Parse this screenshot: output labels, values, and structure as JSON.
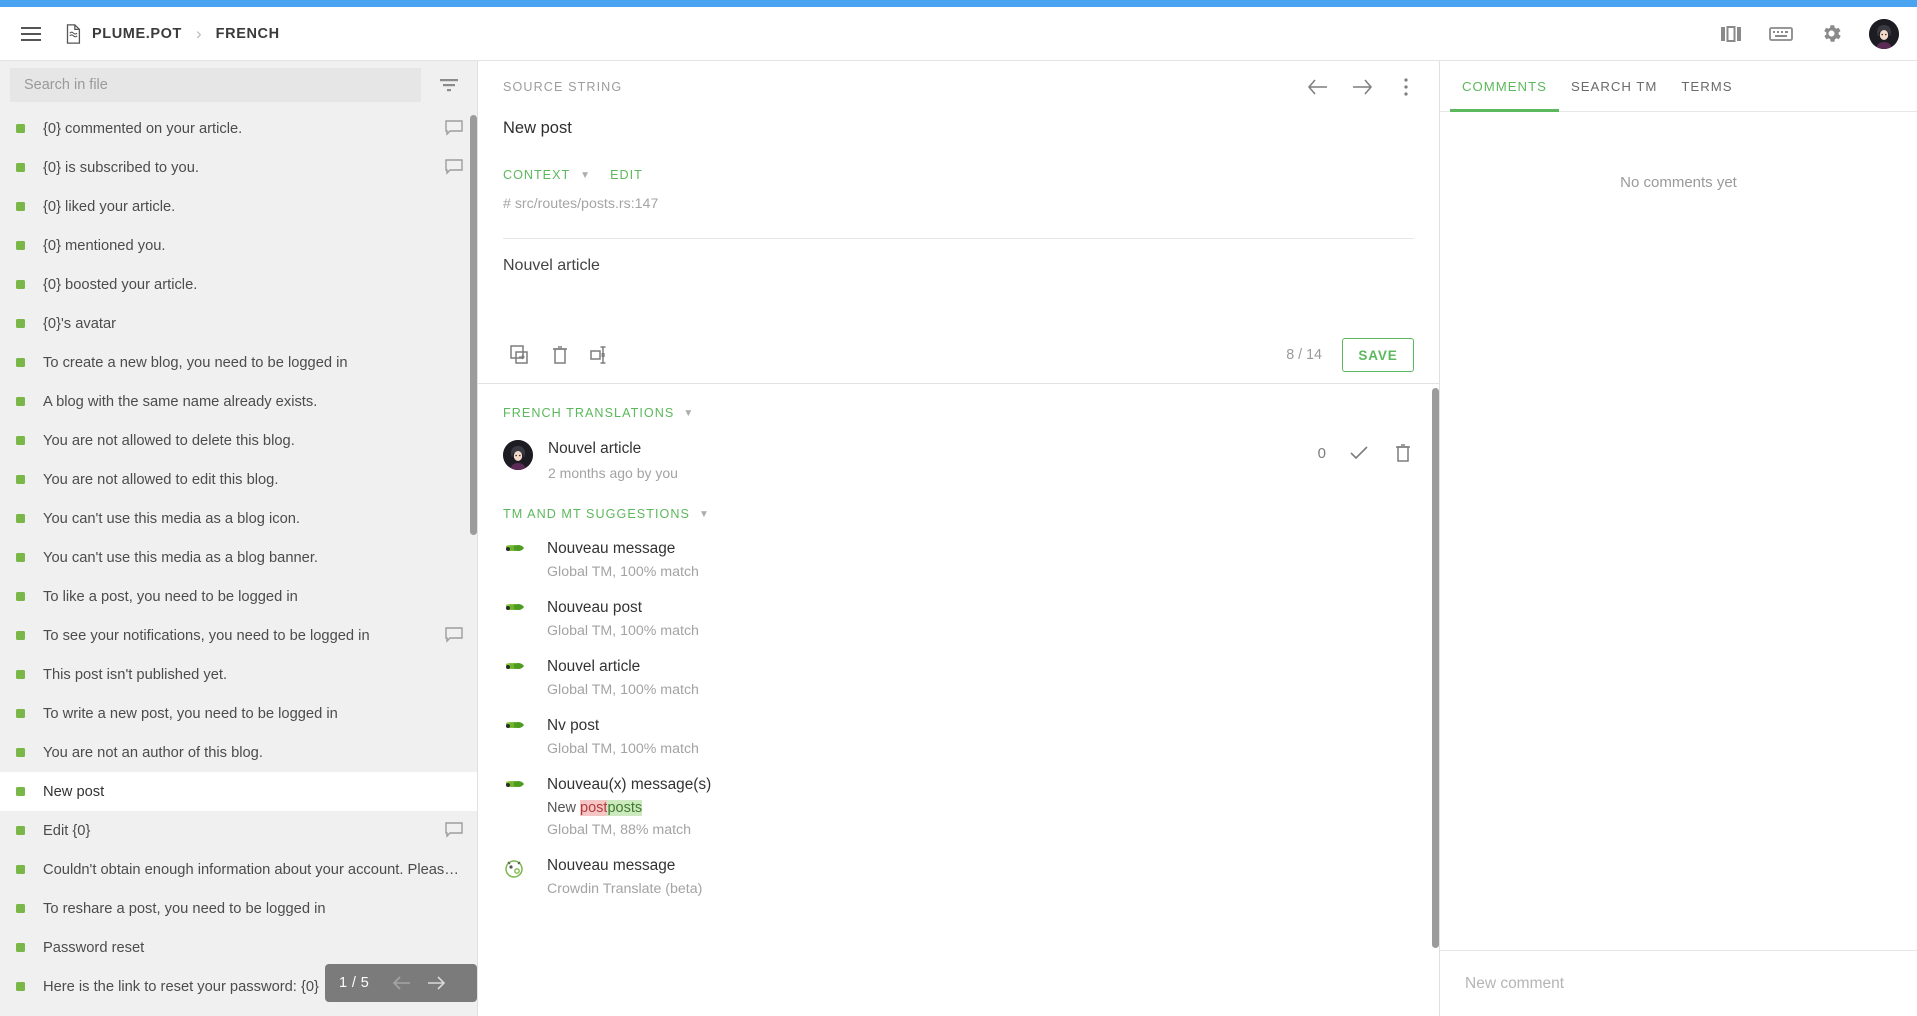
{
  "header": {
    "menu_icon": "hamburger-menu-icon",
    "project_name": "PLUME.POT",
    "separator": "›",
    "current_page": "FRENCH",
    "icons": [
      "layout-columns-icon",
      "keyboard-icon",
      "gear-icon"
    ],
    "avatar": "user-avatar"
  },
  "sidebar": {
    "search": {
      "placeholder": "Search in file",
      "value": ""
    },
    "filter_icon": "filter-icon",
    "items": [
      {
        "label": "{0} commented on your article.",
        "has_comment": true,
        "selected": false
      },
      {
        "label": "{0} is subscribed to you.",
        "has_comment": true,
        "selected": false
      },
      {
        "label": "{0} liked your article.",
        "has_comment": false,
        "selected": false
      },
      {
        "label": "{0} mentioned you.",
        "has_comment": false,
        "selected": false
      },
      {
        "label": "{0} boosted your article.",
        "has_comment": false,
        "selected": false
      },
      {
        "label": "{0}'s avatar",
        "has_comment": false,
        "selected": false
      },
      {
        "label": "To create a new blog, you need to be logged in",
        "has_comment": false,
        "selected": false
      },
      {
        "label": "A blog with the same name already exists.",
        "has_comment": false,
        "selected": false
      },
      {
        "label": "You are not allowed to delete this blog.",
        "has_comment": false,
        "selected": false
      },
      {
        "label": "You are not allowed to edit this blog.",
        "has_comment": false,
        "selected": false
      },
      {
        "label": "You can't use this media as a blog icon.",
        "has_comment": false,
        "selected": false
      },
      {
        "label": "You can't use this media as a blog banner.",
        "has_comment": false,
        "selected": false
      },
      {
        "label": "To like a post, you need to be logged in",
        "has_comment": false,
        "selected": false
      },
      {
        "label": "To see your notifications, you need to be logged in",
        "has_comment": true,
        "selected": false
      },
      {
        "label": "This post isn't published yet.",
        "has_comment": false,
        "selected": false
      },
      {
        "label": "To write a new post, you need to be logged in",
        "has_comment": false,
        "selected": false
      },
      {
        "label": "You are not an author of this blog.",
        "has_comment": false,
        "selected": false
      },
      {
        "label": "New post",
        "has_comment": false,
        "selected": true
      },
      {
        "label": "Edit {0}",
        "has_comment": true,
        "selected": false
      },
      {
        "label": "Couldn't obtain enough information about your account. Please m…",
        "has_comment": false,
        "selected": false
      },
      {
        "label": "To reshare a post, you need to be logged in",
        "has_comment": false,
        "selected": false
      },
      {
        "label": "Password reset",
        "has_comment": false,
        "selected": false
      },
      {
        "label": "Here is the link to reset your password: {0}",
        "has_comment": false,
        "selected": false
      }
    ],
    "pager": {
      "text": "1 / 5",
      "prev_icon": "arrow-left-icon",
      "next_icon": "arrow-right-icon"
    }
  },
  "source": {
    "title": "SOURCE STRING",
    "prev_icon": "arrow-left-icon",
    "next_icon": "arrow-right-icon",
    "more_icon": "more-vertical-icon",
    "text": "New post",
    "context_label": "CONTEXT",
    "edit_label": "EDIT",
    "context_path": "# src/routes/posts.rs:147"
  },
  "editor": {
    "translation_value": "Nouvel article",
    "placeholder": "",
    "tools": [
      "copy-source-icon",
      "clear-translation-icon",
      "insert-tag-icon"
    ],
    "counter": "8 / 14",
    "save_label": "SAVE"
  },
  "translations_section": {
    "title": "FRENCH TRANSLATIONS",
    "caret": "▾",
    "items": [
      {
        "text": "Nouvel article",
        "meta": "2 months ago by you",
        "votes": "0",
        "approve_icon": "check-icon",
        "delete_icon": "trash-icon"
      }
    ]
  },
  "suggestions_section": {
    "title": "TM AND MT SUGGESTIONS",
    "caret": "▾",
    "items": [
      {
        "text": "Nouveau message",
        "diff": null,
        "meta": "Global TM, 100% match",
        "source_icon": "crowdin-tm-icon"
      },
      {
        "text": "Nouveau post",
        "diff": null,
        "meta": "Global TM, 100% match",
        "source_icon": "crowdin-tm-icon"
      },
      {
        "text": "Nouvel article",
        "diff": null,
        "meta": "Global TM, 100% match",
        "source_icon": "crowdin-tm-icon"
      },
      {
        "text": "Nv post",
        "diff": null,
        "meta": "Global TM, 100% match",
        "source_icon": "crowdin-tm-icon"
      },
      {
        "text": "Nouveau(x) message(s)",
        "diff": {
          "prefix": "New ",
          "deleted": "post",
          "inserted": "posts"
        },
        "meta": "Global TM, 88% match",
        "source_icon": "crowdin-tm-icon"
      },
      {
        "text": "Nouveau message",
        "diff": null,
        "meta": "Crowdin Translate (beta)",
        "source_icon": "crowdin-mt-icon"
      }
    ]
  },
  "right_panel": {
    "tabs": [
      {
        "label": "COMMENTS",
        "active": true
      },
      {
        "label": "SEARCH TM",
        "active": false
      },
      {
        "label": "TERMS",
        "active": false
      }
    ],
    "empty_text": "No comments yet",
    "comment_placeholder": "New comment"
  },
  "colors": {
    "accent_green": "#5cb85c",
    "dot_green": "#7ab648",
    "top_strip_blue": "#4aa3f0",
    "sidebar_bg": "#f0f0f0",
    "diff_delete": "#f5c6c6",
    "diff_insert": "#cde9c0"
  }
}
